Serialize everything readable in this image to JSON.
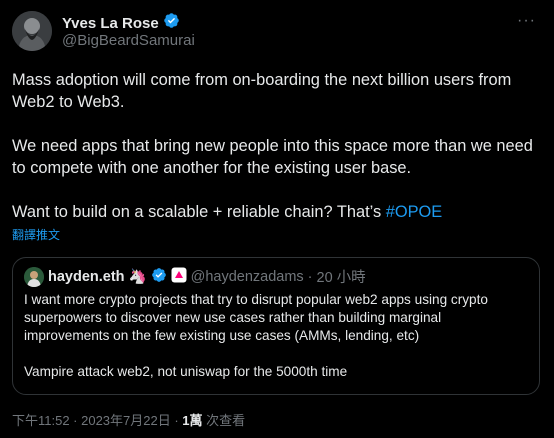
{
  "author": {
    "display_name": "Yves La Rose",
    "handle": "@BigBeardSamurai"
  },
  "more_label": "···",
  "tweet": {
    "line1": "Mass adoption will come from on-boarding the next billion users from Web2 to Web3.",
    "line2": "We need apps that bring new people into this space more than we need to compete with one another for the existing user base.",
    "line3_prefix": "Want to build on a scalable + reliable chain? That’s ",
    "hashtag": "#OPOE",
    "translate_label": "翻譯推文"
  },
  "quote": {
    "display_name": "hayden.eth",
    "badge_emoji": "🦄",
    "handle": "@haydenzadams",
    "separator": "·",
    "time": "20 小時",
    "para1": "I want more crypto projects that try to disrupt popular web2 apps using crypto superpowers to discover new use cases rather than building marginal improvements on the few existing use cases (AMMs, lending, etc)",
    "para2": "Vampire attack web2, not uniswap for the 5000th time"
  },
  "footer": {
    "timestamp": "下午11:52 · 2023年7月22日 · ",
    "views_count": "1萬",
    "views_label": " 次查看"
  },
  "colors": {
    "background": "#000000",
    "text": "#e7e9ea",
    "secondary": "#71767b",
    "accent": "#1d9bf0",
    "border": "#2f3336"
  }
}
